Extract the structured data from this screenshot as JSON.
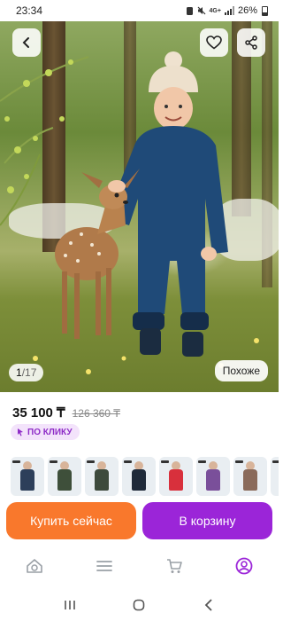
{
  "status_bar": {
    "time": "23:34",
    "network": "4G+",
    "battery": "26%"
  },
  "photo": {
    "counter_current": "1",
    "counter_total": "/17",
    "similar_label": "Похоже"
  },
  "price": {
    "current": "35 100 ₸",
    "old": "126 360 ₸",
    "badge": "ПО КЛИКУ"
  },
  "thumbnails": [
    {
      "color": "#2d3f5a"
    },
    {
      "color": "#3e4f3a"
    },
    {
      "color": "#3d4a3c"
    },
    {
      "color": "#1f2a3a"
    },
    {
      "color": "#d8303c"
    },
    {
      "color": "#7a4f9a"
    },
    {
      "color": "#8a6a5a"
    },
    {
      "color": "#2f3b4d"
    }
  ],
  "actions": {
    "buy_now": "Купить сейчас",
    "add_to_cart": "В корзину"
  },
  "bottom_nav": {
    "items": [
      "home-search-icon",
      "catalog-icon",
      "cart-icon",
      "profile-icon"
    ],
    "active_color": "#9b25d8"
  }
}
